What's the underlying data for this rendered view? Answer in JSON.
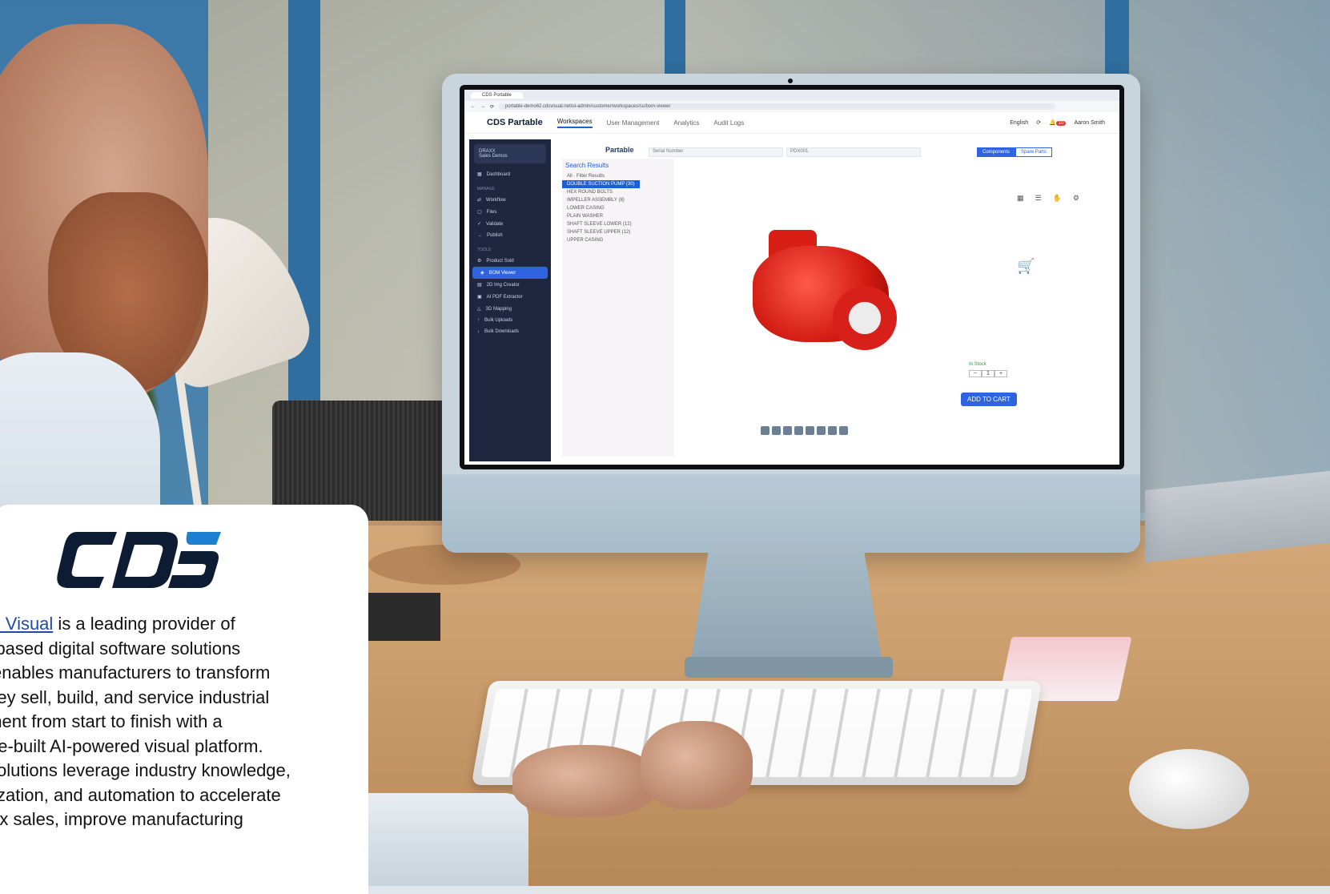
{
  "card": {
    "link_text": "S Visual",
    "lines": [
      " is a leading provider of",
      "al-based digital software solutions",
      "enables manufacturers to transform",
      "they sell, build, and service industrial",
      "pment from start to finish with a",
      "ose-built AI-powered visual platform.",
      "solutions leverage industry knowledge,",
      "alization, and automation to accelerate",
      "plex sales, improve manufacturing"
    ]
  },
  "screen": {
    "tab_title": "CDS Portable",
    "url": "portable-demo62.cdsvisual.net/ui-admin/customer/workspaces/ss/bom-viewer",
    "brand": "CDS Partable",
    "nav": [
      "Workspaces",
      "User Management",
      "Analytics",
      "Audit Logs"
    ],
    "language": "English",
    "notification_count": "10",
    "user": "Aaron Smith",
    "sidebar": {
      "workspace": "DRAXX",
      "workspace_sub": "Sales Demos",
      "items": [
        "Dashboard"
      ],
      "manage_label": "MANAGE",
      "manage_items": [
        "Workflow",
        "Files",
        "Validate",
        "Publish"
      ],
      "tools_label": "TOOLS",
      "tools_items": [
        "Product Sold",
        "BOM Viewer",
        "2D Img Creator",
        "AI PDF Extractor",
        "3D Mapping",
        "Bulk Uploads",
        "Bulk Downloads"
      ]
    },
    "partable_label": "Partable",
    "serial_placeholder": "Serial Number",
    "serial_value": "PDX001",
    "toggle_components": "Components",
    "toggle_spare": "Spare Parts",
    "search_results": "Search Results",
    "filter_all": "All",
    "filter_placeholder": "Filter Results",
    "tree": [
      "DOUBLE SUCTION PUMP (30)",
      "HEX ROUND BOLTS",
      "IMPELLER ASSEMBLY (8)",
      "LOWER CASING",
      "PLAIN WASHER",
      "SHAFT SLEEVE LOWER (12)",
      "SHAFT SLEEVE UPPER (12)",
      "UPPER CASING"
    ],
    "stock_label": "In Stock",
    "qty": "1",
    "add_to_cart": "ADD TO CART"
  },
  "colors": {
    "brand_dark": "#0d1b33",
    "brand_blue": "#1d7fd0",
    "accent": "#2f63e0",
    "pump_red": "#d11a12"
  }
}
